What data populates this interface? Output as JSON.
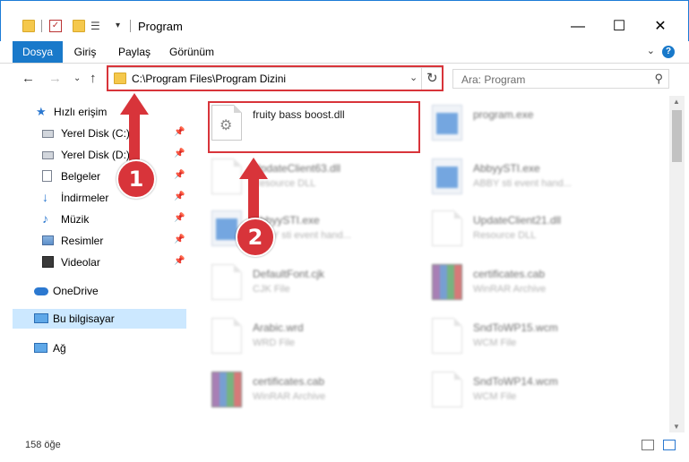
{
  "window": {
    "title": "Program",
    "minimize": "—",
    "maximize": "☐",
    "close": "✕"
  },
  "ribbon": {
    "tabs": [
      "Dosya",
      "Giriş",
      "Paylaş",
      "Görünüm"
    ],
    "help": "?"
  },
  "nav": {
    "address": "C:\\Program Files\\Program Dizini",
    "search_placeholder": "Ara: Program"
  },
  "sidebar": {
    "items": [
      {
        "label": "Hızlı erişim",
        "icon": "star-icon"
      },
      {
        "label": "Yerel Disk (C:)",
        "icon": "disk-icon"
      },
      {
        "label": "Yerel Disk (D:)",
        "icon": "disk-icon"
      },
      {
        "label": "Belgeler",
        "icon": "documents-icon"
      },
      {
        "label": "İndirmeler",
        "icon": "download-icon"
      },
      {
        "label": "Müzik",
        "icon": "music-icon"
      },
      {
        "label": "Resimler",
        "icon": "pictures-icon"
      },
      {
        "label": "Videolar",
        "icon": "videos-icon"
      },
      {
        "label": "OneDrive",
        "icon": "cloud-icon"
      },
      {
        "label": "Bu bilgisayar",
        "icon": "computer-icon"
      },
      {
        "label": "Ağ",
        "icon": "network-icon"
      }
    ]
  },
  "files": [
    {
      "name": "fruity bass boost.dll",
      "type": "",
      "icon": "dll-icon"
    },
    {
      "name": "program.exe",
      "type": "",
      "icon": "exe-icon"
    },
    {
      "name": "UpdateClient63.dll",
      "type": "Resource DLL",
      "icon": "dll-icon"
    },
    {
      "name": "AbbyySTI.exe",
      "type": "ABBY sti event hand...",
      "icon": "exe-icon"
    },
    {
      "name": "AbbyySTI.exe",
      "type": "ABBY sti event hand...",
      "icon": "exe-icon"
    },
    {
      "name": "UpdateClient21.dll",
      "type": "Resource DLL",
      "icon": "dll-icon"
    },
    {
      "name": "DefaultFont.cjk",
      "type": "CJK File",
      "icon": "document-icon"
    },
    {
      "name": "certificates.cab",
      "type": "WinRAR Archive",
      "icon": "rar-icon"
    },
    {
      "name": "Arabic.wrd",
      "type": "WRD File",
      "icon": "document-icon"
    },
    {
      "name": "SndToWP15.wcm",
      "type": "WCM File",
      "icon": "document-icon"
    },
    {
      "name": "certificates.cab",
      "type": "WinRAR Archive",
      "icon": "rar-icon"
    },
    {
      "name": "SndToWP14.wcm",
      "type": "WCM File",
      "icon": "document-icon"
    }
  ],
  "status": {
    "count": "158 öğe"
  },
  "callouts": [
    "1",
    "2"
  ],
  "colors": {
    "accent": "#1979ca",
    "highlight": "#d8343a",
    "selected": "#cce8ff"
  }
}
